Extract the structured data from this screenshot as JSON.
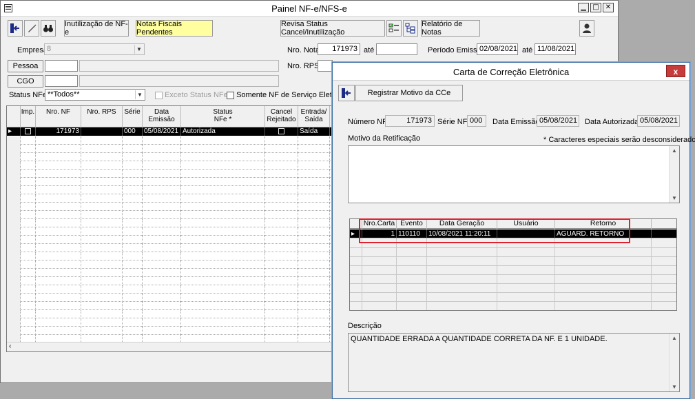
{
  "main": {
    "title": "Painel NF-e/NFS-e",
    "toolbar": {
      "inutilizacao": "Inutilização de NF-e",
      "pendentes": "Notas Fiscais Pendentes",
      "revisa": "Revisa Status Cancel/Inutilização",
      "relatorio": "Relatório de Notas"
    },
    "filters": {
      "empresa_label": "Empresa",
      "empresa_value": "8",
      "pessoa_label": "Pessoa",
      "cgo_label": "CGO",
      "status_label": "Status NFe",
      "status_value": "**Todos**",
      "exceto_label": "Exceto Status NFe",
      "servico_label": "Somente NF de Serviço Eletrônic",
      "nro_nota_label": "Nro. Nota",
      "nro_nota_value": "171973",
      "ate_label": "até",
      "nro_rps_label": "Nro. RPS",
      "periodo_label": "Período Emissão",
      "periodo_de": "02/08/2021",
      "periodo_ate_label": "até",
      "periodo_ate": "11/08/2021"
    },
    "grid": {
      "headers": [
        "Imp.",
        "Nro. NF",
        "Nro. RPS",
        "Série",
        "Data\nEmissão",
        "Status\nNFe *",
        "Cancel\nRejeitado",
        "Entrada/\nSaída"
      ],
      "row": {
        "nf": "171973",
        "rps": "",
        "serie": "000",
        "data": "05/08/2021",
        "status": "Autorizada",
        "tipo": "Saída"
      }
    }
  },
  "dialog": {
    "title": "Carta de Correção Eletrônica",
    "registrar": "Registrar Motivo da CCe",
    "numero_nf_label": "Número NF",
    "numero_nf": "171973",
    "serie_label": "Série NF",
    "serie": "000",
    "data_emissao_label": "Data Emissão",
    "data_emissao": "05/08/2021",
    "data_autorizada_label": "Data Autorizada",
    "data_autorizada": "05/08/2021",
    "motivo_label": "Motivo da Retificação",
    "especiais_label": "* Caracteres especiais serão desconsiderados.",
    "cartas": {
      "headers": [
        "Nro.Carta",
        "Evento",
        "Data Geração",
        "Usuário",
        "Retorno"
      ],
      "row": {
        "nro": "1",
        "evento": "110110",
        "data": "10/08/2021 11:20:11",
        "usuario": "",
        "retorno": "AGUARD. RETORNO"
      }
    },
    "descricao_label": "Descrição",
    "descricao": "QUANTIDADE ERRADA  A QUANTIDADE CORRETA DA NF. E 1 UNIDADE."
  }
}
